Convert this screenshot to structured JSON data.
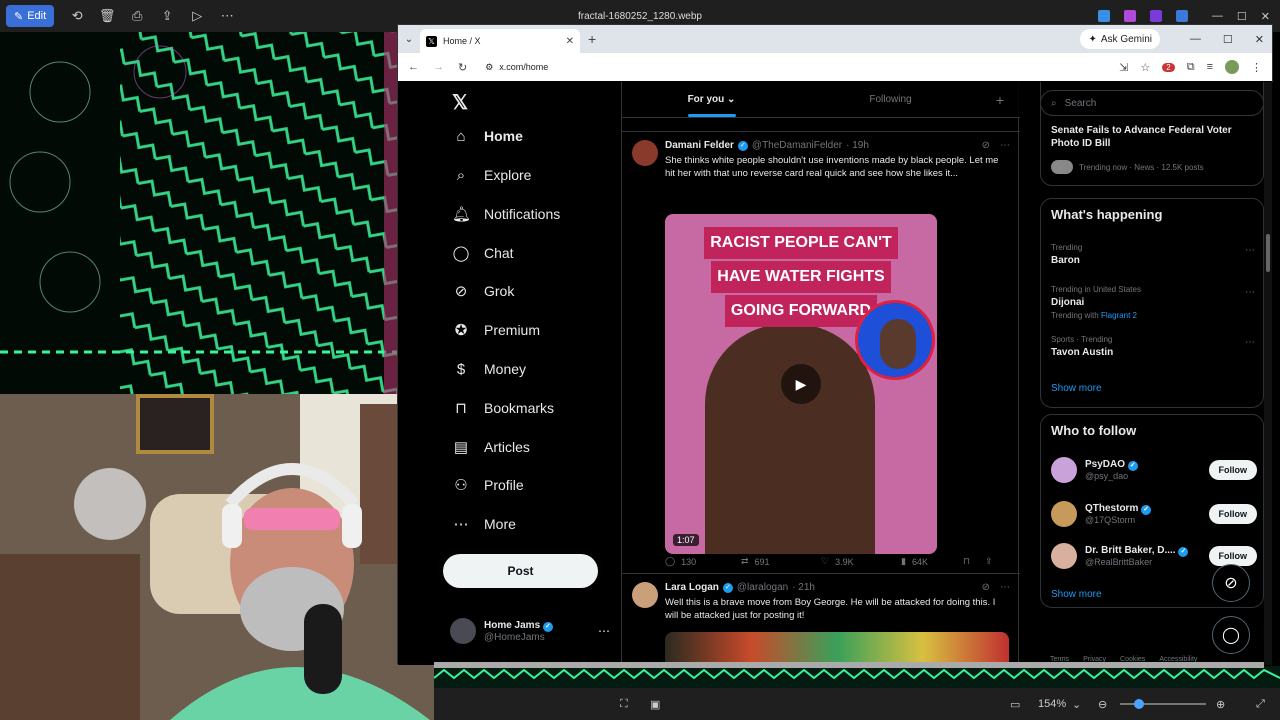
{
  "viewer": {
    "edit_label": "Edit",
    "file_title": "fractal-1680252_1280.webp",
    "zoom": "154%"
  },
  "browser": {
    "tab_title": "Home / X",
    "gemini_label": "Ask Gemini",
    "url": "x.com/home",
    "ext_badge": "2"
  },
  "nav": {
    "items": [
      {
        "label": "Home",
        "icon": "home-icon",
        "glyph": "⌂"
      },
      {
        "label": "Explore",
        "icon": "search-icon",
        "glyph": "⌕"
      },
      {
        "label": "Notifications",
        "icon": "bell-icon",
        "glyph": "🔔︎"
      },
      {
        "label": "Chat",
        "icon": "chat-icon",
        "glyph": "◯"
      },
      {
        "label": "Grok",
        "icon": "grok-icon",
        "glyph": "⊘"
      },
      {
        "label": "Premium",
        "icon": "premium-icon",
        "glyph": "✪"
      },
      {
        "label": "Money",
        "icon": "money-icon",
        "glyph": "$"
      },
      {
        "label": "Bookmarks",
        "icon": "bookmark-icon",
        "glyph": "⊓"
      },
      {
        "label": "Articles",
        "icon": "articles-icon",
        "glyph": "▤"
      },
      {
        "label": "Profile",
        "icon": "profile-icon",
        "glyph": "⚇"
      },
      {
        "label": "More",
        "icon": "more-icon",
        "glyph": "⋯"
      }
    ],
    "post_label": "Post",
    "account_name": "Home Jams",
    "account_handle": "@HomeJams"
  },
  "timeline": {
    "tab_for_you": "For you",
    "tab_following": "Following",
    "tweets": [
      {
        "name": "Damani Felder",
        "handle": "@TheDamaniFelder",
        "time": "· 19h",
        "text": "She thinks white people shouldn't use inventions made by black people. Let me hit her with that uno reverse card real quick and see how she likes it...",
        "media_caption": [
          "RACIST PEOPLE CAN'T",
          "HAVE WATER FIGHTS",
          "GOING FORWARD"
        ],
        "duration": "1:07",
        "replies": "130",
        "reposts": "691",
        "likes": "3.9K",
        "views": "64K"
      },
      {
        "name": "Lara Logan",
        "handle": "@laralogan",
        "time": "· 21h",
        "text": "Well this is a brave move from Boy George. He will be attacked for doing this. I will be attacked just for posting it!"
      }
    ]
  },
  "sidebar": {
    "search_placeholder": "Search",
    "top_trend": {
      "title": "Senate Fails to Advance Federal Voter Photo ID Bill",
      "meta": "Trending now · News · 12.5K posts"
    },
    "whats_happening_title": "What's happening",
    "trends": [
      {
        "meta": "Trending",
        "name": "Baron",
        "extra": "",
        "extra_link": ""
      },
      {
        "meta": "Trending in United States",
        "name": "Dijonai",
        "extra": "Trending with ",
        "extra_link": "Flagrant 2"
      },
      {
        "meta": "Sports · Trending",
        "name": "Tavon Austin",
        "extra": "",
        "extra_link": ""
      }
    ],
    "show_more": "Show more",
    "who_to_follow_title": "Who to follow",
    "follow_suggestions": [
      {
        "name": "PsyDAO",
        "handle": "@psy_dao",
        "color": "#c9a2d9"
      },
      {
        "name": "QThestorm",
        "handle": "@17QStorm",
        "color": "#c59a5a"
      },
      {
        "name": "Dr. Britt Baker, D....",
        "handle": "@RealBrittBaker",
        "color": "#d8b0a0"
      }
    ],
    "follow_label": "Follow",
    "footer": [
      "Terms",
      "Privacy",
      "Cookies",
      "Accessibility"
    ]
  }
}
